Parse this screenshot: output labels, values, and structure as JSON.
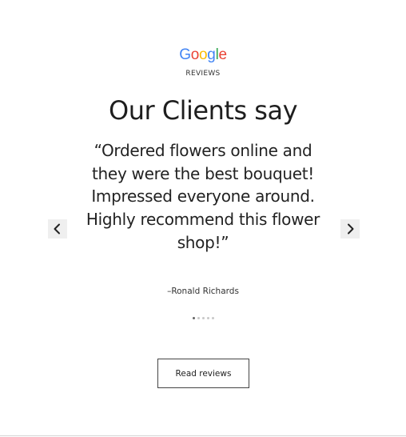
{
  "logo": {
    "letters": [
      {
        "char": "G",
        "color": "#4285F4"
      },
      {
        "char": "o",
        "color": "#EA4335"
      },
      {
        "char": "o",
        "color": "#FBBC05"
      },
      {
        "char": "g",
        "color": "#4285F4"
      },
      {
        "char": "l",
        "color": "#34A853"
      },
      {
        "char": "e",
        "color": "#EA4335"
      }
    ],
    "subtitle": "REVIEWS"
  },
  "section": {
    "title": "Our Clients say"
  },
  "review": {
    "quote": "“Ordered flowers online and they were the best bouquet! Impressed everyone around. Highly recommend this flower shop!”",
    "author": "–Ronald Richards"
  },
  "carousel": {
    "prev_icon": "chevron-left-icon",
    "next_icon": "chevron-right-icon",
    "slide_count": 5,
    "active_index": 0
  },
  "actions": {
    "read_reviews_label": "Read reviews"
  }
}
